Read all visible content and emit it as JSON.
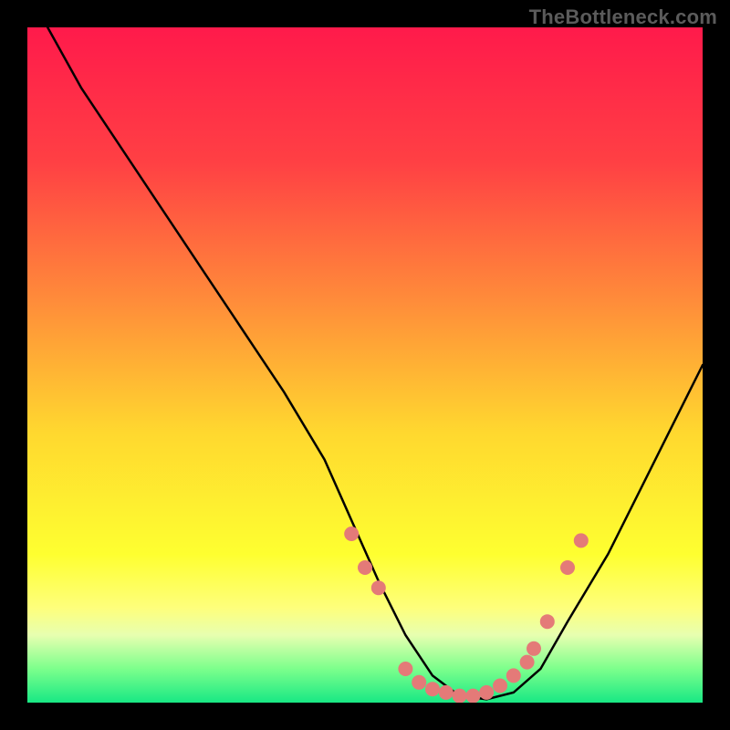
{
  "watermark": "TheBottleneck.com",
  "chart_data": {
    "type": "line",
    "title": "",
    "xlabel": "",
    "ylabel": "",
    "xlim": [
      0,
      100
    ],
    "ylim": [
      0,
      100
    ],
    "grid": false,
    "legend": false,
    "series": [
      {
        "name": "curve",
        "x": [
          3,
          8,
          14,
          20,
          26,
          32,
          38,
          44,
          48,
          52,
          56,
          60,
          64,
          68,
          72,
          76,
          80,
          86,
          92,
          98,
          100
        ],
        "y": [
          100,
          91,
          82,
          73,
          64,
          55,
          46,
          36,
          27,
          18,
          10,
          4,
          1,
          0.5,
          1.5,
          5,
          12,
          22,
          34,
          46,
          50
        ]
      }
    ],
    "markers": [
      {
        "x": 48,
        "y": 25
      },
      {
        "x": 50,
        "y": 20
      },
      {
        "x": 52,
        "y": 17
      },
      {
        "x": 56,
        "y": 5
      },
      {
        "x": 58,
        "y": 3
      },
      {
        "x": 60,
        "y": 2
      },
      {
        "x": 62,
        "y": 1.5
      },
      {
        "x": 64,
        "y": 1
      },
      {
        "x": 66,
        "y": 1
      },
      {
        "x": 68,
        "y": 1.5
      },
      {
        "x": 70,
        "y": 2.5
      },
      {
        "x": 72,
        "y": 4
      },
      {
        "x": 74,
        "y": 6
      },
      {
        "x": 75,
        "y": 8
      },
      {
        "x": 77,
        "y": 12
      },
      {
        "x": 80,
        "y": 20
      },
      {
        "x": 82,
        "y": 24
      }
    ],
    "background_gradient": {
      "stops": [
        {
          "offset": 0,
          "color": "#ff1a4b"
        },
        {
          "offset": 0.2,
          "color": "#ff4044"
        },
        {
          "offset": 0.4,
          "color": "#ff8a3a"
        },
        {
          "offset": 0.6,
          "color": "#ffd82f"
        },
        {
          "offset": 0.78,
          "color": "#feff30"
        },
        {
          "offset": 0.86,
          "color": "#feff7c"
        },
        {
          "offset": 0.9,
          "color": "#e7ffb0"
        },
        {
          "offset": 0.95,
          "color": "#7cff8c"
        },
        {
          "offset": 1.0,
          "color": "#18e884"
        }
      ]
    },
    "marker_style": {
      "fill": "#e47a78",
      "radius_px": 8
    }
  }
}
